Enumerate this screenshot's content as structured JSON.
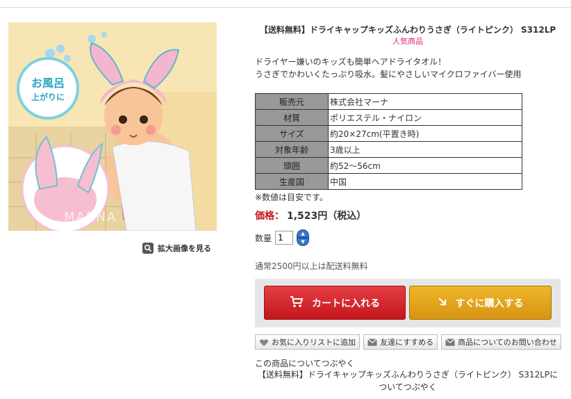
{
  "product": {
    "title": "【送料無料】ドライキャップキッズふんわりうさぎ（ライトピンク） S312LP",
    "popular_label": "人気商品",
    "description": [
      "ドライヤー嫌いのキッズも簡単ヘアドライタオル！",
      "うさぎでかわいくたっぷり吸水。髪にやさしいマイクロファイバー使用"
    ],
    "image": {
      "badge_line1": "お風呂",
      "badge_line2": "上がりに",
      "watermark": "MARNA",
      "zoom_label": "拡大画像を見る"
    }
  },
  "specs": [
    {
      "key": "販売元",
      "value": "株式会社マーナ"
    },
    {
      "key": "材質",
      "value": "ポリエステル・ナイロン"
    },
    {
      "key": "サイズ",
      "value": "約20×27cm(平置き時)"
    },
    {
      "key": "対象年齢",
      "value": "3歳以上"
    },
    {
      "key": "頭囲",
      "value": "約52～56cm"
    },
    {
      "key": "生産国",
      "value": "中国"
    }
  ],
  "specs_note": "※数値は目安です。",
  "price": {
    "label": "価格：",
    "value": "1,523円（税込）"
  },
  "quantity": {
    "label": "数量",
    "value": "1"
  },
  "free_shipping": "通常2500円以上は配送料無料",
  "buttons": {
    "cart": "カートに入れる",
    "buy_now": "すぐに購入する",
    "wishlist": "お気に入りリストに追加",
    "recommend": "友達にすすめる",
    "inquiry": "商品についてのお問い合わせ"
  },
  "tweet": {
    "heading": "この商品についてつぶやく",
    "line1": "【送料無料】ドライキャップキッズふんわりうさぎ（ライトピンク） S312LPに",
    "line2": "ついてつぶやく"
  },
  "colors": {
    "price_red": "#c4161c",
    "cart_red": "#c4161c",
    "buy_gold": "#d69410",
    "popular_pink": "#e2217a"
  }
}
